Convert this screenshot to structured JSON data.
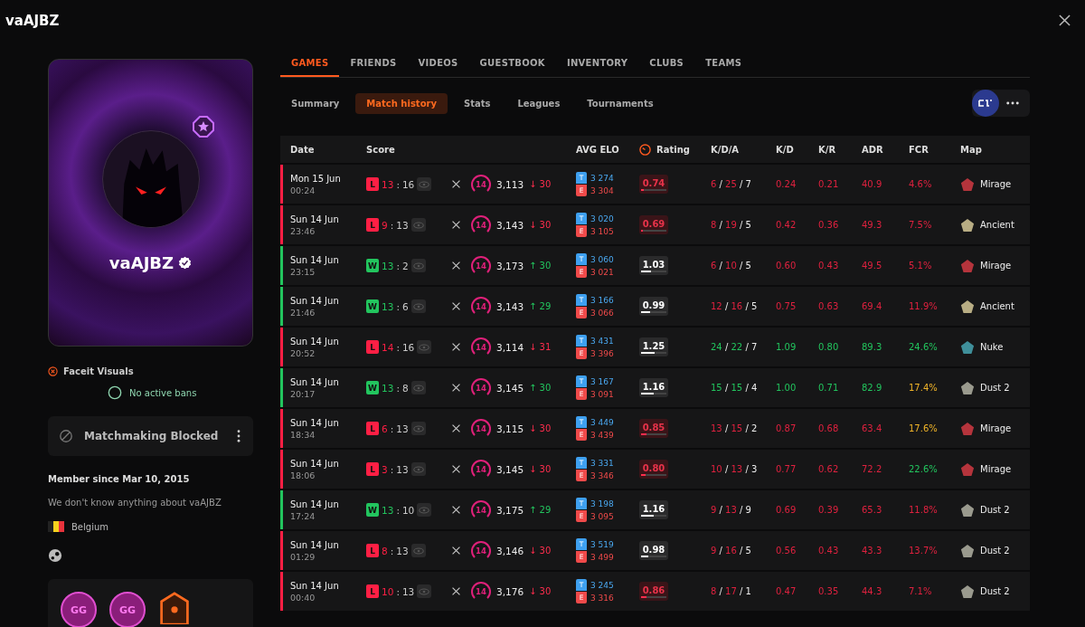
{
  "window": {
    "title": "vaAJBZ"
  },
  "profile": {
    "name": "vaAJBZ",
    "verified": true,
    "visuals_label": "Faceit Visuals",
    "bans": "No active bans",
    "blocked": "Matchmaking Blocked",
    "member_since": "Member since Mar 10, 2015",
    "about": "We don't know anything about vaAJBZ",
    "country": "Belgium",
    "badges": [
      {
        "kind": "gg",
        "label": "GG"
      },
      {
        "kind": "gg",
        "label": "GG"
      },
      {
        "kind": "soldier"
      }
    ]
  },
  "main_tabs": [
    {
      "label": "GAMES",
      "selected": true
    },
    {
      "label": "FRIENDS",
      "selected": false
    },
    {
      "label": "VIDEOS",
      "selected": false
    },
    {
      "label": "GUESTBOOK",
      "selected": false
    },
    {
      "label": "INVENTORY",
      "selected": false
    },
    {
      "label": "CLUBS",
      "selected": false
    },
    {
      "label": "TEAMS",
      "selected": false
    }
  ],
  "sub_tabs": [
    {
      "label": "Summary",
      "selected": false
    },
    {
      "label": "Match history",
      "selected": true
    },
    {
      "label": "Stats",
      "selected": false
    },
    {
      "label": "Leagues",
      "selected": false
    },
    {
      "label": "Tournaments",
      "selected": false
    }
  ],
  "table": {
    "columns": [
      "Date",
      "Score",
      "AVG ELO",
      "Rating",
      "K/D/A",
      "K/D",
      "K/R",
      "ADR",
      "FCR",
      "Map"
    ],
    "rows": [
      {
        "date": "Mon 15 Jun",
        "time": "00:24",
        "result": "L",
        "won": false,
        "score": {
          "own": "13",
          "sep": ":",
          "opp": "16"
        },
        "skill": "14",
        "elo": "3,113",
        "change": "↓ 30",
        "gain": false,
        "team": {
          "tag": "T",
          "elo": "3 274"
        },
        "enemy": {
          "tag": "E",
          "elo": "3 304"
        },
        "rating": "0.74",
        "rating_low": true,
        "level": 0.1,
        "kda": {
          "k": "6",
          "s1": "/",
          "d": "25",
          "s2": "/",
          "a": "7"
        },
        "good": false,
        "kd": "0.24",
        "kr": "0.21",
        "adr": "40.9",
        "fcr": {
          "value": "4.6%",
          "color": "#e0213f"
        },
        "map": {
          "name": "Mirage",
          "color": "#b5343c"
        }
      },
      {
        "date": "Sun 14 Jun",
        "time": "23:46",
        "result": "L",
        "won": false,
        "score": {
          "own": "9",
          "sep": ":",
          "opp": "13"
        },
        "skill": "14",
        "elo": "3,143",
        "change": "↓ 30",
        "gain": false,
        "team": {
          "tag": "T",
          "elo": "3 020"
        },
        "enemy": {
          "tag": "E",
          "elo": "3 105"
        },
        "rating": "0.69",
        "rating_low": true,
        "level": 0.08,
        "kda": {
          "k": "8",
          "s1": "/",
          "d": "19",
          "s2": "/",
          "a": "5"
        },
        "good": false,
        "kd": "0.42",
        "kr": "0.36",
        "adr": "49.3",
        "fcr": {
          "value": "7.5%",
          "color": "#e0213f"
        },
        "map": {
          "name": "Ancient",
          "color": "#b8ad84"
        }
      },
      {
        "date": "Sun 14 Jun",
        "time": "23:15",
        "result": "W",
        "won": true,
        "score": {
          "own": "13",
          "sep": ":",
          "opp": "2"
        },
        "skill": "14",
        "elo": "3,173",
        "change": "↑ 30",
        "gain": true,
        "team": {
          "tag": "T",
          "elo": "3 060"
        },
        "enemy": {
          "tag": "E",
          "elo": "3 021"
        },
        "rating": "1.03",
        "rating_low": false,
        "level": 0.4,
        "kda": {
          "k": "6",
          "s1": "/",
          "d": "10",
          "s2": "/",
          "a": "5"
        },
        "good": false,
        "kd": "0.60",
        "kr": "0.43",
        "adr": "49.5",
        "fcr": {
          "value": "5.1%",
          "color": "#e0213f"
        },
        "map": {
          "name": "Mirage",
          "color": "#b5343c"
        }
      },
      {
        "date": "Sun 14 Jun",
        "time": "21:46",
        "result": "W",
        "won": true,
        "score": {
          "own": "13",
          "sep": ":",
          "opp": "6"
        },
        "skill": "14",
        "elo": "3,143",
        "change": "↑ 29",
        "gain": true,
        "team": {
          "tag": "T",
          "elo": "3 166"
        },
        "enemy": {
          "tag": "E",
          "elo": "3 066"
        },
        "rating": "0.99",
        "rating_low": false,
        "level": 0.35,
        "kda": {
          "k": "12",
          "s1": "/",
          "d": "16",
          "s2": "/",
          "a": "5"
        },
        "good": false,
        "kd": "0.75",
        "kr": "0.63",
        "adr": "69.4",
        "fcr": {
          "value": "11.9%",
          "color": "#e0213f"
        },
        "map": {
          "name": "Ancient",
          "color": "#b8ad84"
        }
      },
      {
        "date": "Sun 14 Jun",
        "time": "20:52",
        "result": "L",
        "won": false,
        "score": {
          "own": "14",
          "sep": ":",
          "opp": "16"
        },
        "skill": "14",
        "elo": "3,114",
        "change": "↓ 31",
        "gain": false,
        "team": {
          "tag": "T",
          "elo": "3 431"
        },
        "enemy": {
          "tag": "E",
          "elo": "3 396"
        },
        "rating": "1.25",
        "rating_low": false,
        "level": 0.55,
        "kda": {
          "k": "24",
          "s1": "/",
          "d": "22",
          "s2": "/",
          "a": "7"
        },
        "good": true,
        "kd": "1.09",
        "kr": "0.80",
        "adr": "89.3",
        "fcr": {
          "value": "24.6%",
          "color": "#22c55e"
        },
        "map": {
          "name": "Nuke",
          "color": "#3f8f9a"
        }
      },
      {
        "date": "Sun 14 Jun",
        "time": "20:17",
        "result": "W",
        "won": true,
        "score": {
          "own": "13",
          "sep": ":",
          "opp": "8"
        },
        "skill": "14",
        "elo": "3,145",
        "change": "↑ 30",
        "gain": true,
        "team": {
          "tag": "T",
          "elo": "3 167"
        },
        "enemy": {
          "tag": "E",
          "elo": "3 091"
        },
        "rating": "1.16",
        "rating_low": false,
        "level": 0.5,
        "kda": {
          "k": "15",
          "s1": "/",
          "d": "15",
          "s2": "/",
          "a": "4"
        },
        "good": true,
        "kd": "1.00",
        "kr": "0.71",
        "adr": "82.9",
        "fcr": {
          "value": "17.4%",
          "color": "#f0b429"
        },
        "map": {
          "name": "Dust 2",
          "color": "#9a9a8e"
        }
      },
      {
        "date": "Sun 14 Jun",
        "time": "18:34",
        "result": "L",
        "won": false,
        "score": {
          "own": "6",
          "sep": ":",
          "opp": "13"
        },
        "skill": "14",
        "elo": "3,115",
        "change": "↓ 30",
        "gain": false,
        "team": {
          "tag": "T",
          "elo": "3 449"
        },
        "enemy": {
          "tag": "E",
          "elo": "3 439"
        },
        "rating": "0.85",
        "rating_low": true,
        "level": 0.2,
        "kda": {
          "k": "13",
          "s1": "/",
          "d": "15",
          "s2": "/",
          "a": "2"
        },
        "good": false,
        "kd": "0.87",
        "kr": "0.68",
        "adr": "63.4",
        "fcr": {
          "value": "17.6%",
          "color": "#f0b429"
        },
        "map": {
          "name": "Mirage",
          "color": "#b5343c"
        }
      },
      {
        "date": "Sun 14 Jun",
        "time": "18:06",
        "result": "L",
        "won": false,
        "score": {
          "own": "3",
          "sep": ":",
          "opp": "13"
        },
        "skill": "14",
        "elo": "3,145",
        "change": "↓ 30",
        "gain": false,
        "team": {
          "tag": "T",
          "elo": "3 331"
        },
        "enemy": {
          "tag": "E",
          "elo": "3 346"
        },
        "rating": "0.80",
        "rating_low": true,
        "level": 0.17,
        "kda": {
          "k": "10",
          "s1": "/",
          "d": "13",
          "s2": "/",
          "a": "3"
        },
        "good": false,
        "kd": "0.77",
        "kr": "0.62",
        "adr": "72.2",
        "fcr": {
          "value": "22.6%",
          "color": "#22c55e"
        },
        "map": {
          "name": "Mirage",
          "color": "#b5343c"
        }
      },
      {
        "date": "Sun 14 Jun",
        "time": "17:24",
        "result": "W",
        "won": true,
        "score": {
          "own": "13",
          "sep": ":",
          "opp": "10"
        },
        "skill": "14",
        "elo": "3,175",
        "change": "↑ 29",
        "gain": true,
        "team": {
          "tag": "T",
          "elo": "3 198"
        },
        "enemy": {
          "tag": "E",
          "elo": "3 095"
        },
        "rating": "1.16",
        "rating_low": false,
        "level": 0.5,
        "kda": {
          "k": "9",
          "s1": "/",
          "d": "13",
          "s2": "/",
          "a": "9"
        },
        "good": false,
        "kd": "0.69",
        "kr": "0.39",
        "adr": "65.3",
        "fcr": {
          "value": "11.8%",
          "color": "#e0213f"
        },
        "map": {
          "name": "Dust 2",
          "color": "#9a9a8e"
        }
      },
      {
        "date": "Sun 14 Jun",
        "time": "01:29",
        "result": "L",
        "won": false,
        "score": {
          "own": "8",
          "sep": ":",
          "opp": "13"
        },
        "skill": "14",
        "elo": "3,146",
        "change": "↓ 30",
        "gain": false,
        "team": {
          "tag": "T",
          "elo": "3 519"
        },
        "enemy": {
          "tag": "E",
          "elo": "3 499"
        },
        "rating": "0.98",
        "rating_low": false,
        "level": 0.3,
        "kda": {
          "k": "9",
          "s1": "/",
          "d": "16",
          "s2": "/",
          "a": "5"
        },
        "good": false,
        "kd": "0.56",
        "kr": "0.43",
        "adr": "43.3",
        "fcr": {
          "value": "13.7%",
          "color": "#e0213f"
        },
        "map": {
          "name": "Dust 2",
          "color": "#9a9a8e"
        }
      },
      {
        "date": "Sun 14 Jun",
        "time": "00:40",
        "result": "L",
        "won": false,
        "score": {
          "own": "10",
          "sep": ":",
          "opp": "13"
        },
        "skill": "14",
        "elo": "3,176",
        "change": "↓ 30",
        "gain": false,
        "team": {
          "tag": "T",
          "elo": "3 245"
        },
        "enemy": {
          "tag": "E",
          "elo": "3 316"
        },
        "rating": "0.86",
        "rating_low": true,
        "level": 0.2,
        "kda": {
          "k": "8",
          "s1": "/",
          "d": "17",
          "s2": "/",
          "a": "1"
        },
        "good": false,
        "kd": "0.47",
        "kr": "0.35",
        "adr": "44.3",
        "fcr": {
          "value": "7.1%",
          "color": "#e0213f"
        },
        "map": {
          "name": "Dust 2",
          "color": "#9a9a8e"
        }
      }
    ]
  }
}
